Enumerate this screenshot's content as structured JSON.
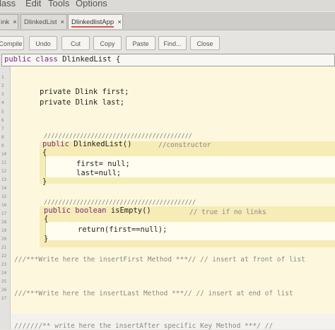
{
  "menu": {
    "items": [
      "lass",
      "Edit",
      "Tools",
      "Options"
    ]
  },
  "tabs": [
    {
      "label": "ink",
      "close": "×"
    },
    {
      "label": "DlinkedList",
      "close": "×"
    },
    {
      "label": "DlinkedlistApp",
      "close": "×"
    }
  ],
  "toolbar": {
    "buttons": [
      "Compile",
      "Undo",
      "Cut",
      "Copy",
      "Paste",
      "Find...",
      "Close"
    ]
  },
  "editor": {
    "line_numbers": [
      "1",
      "2",
      "3",
      "4",
      "5",
      "6",
      "7",
      "8",
      "9",
      "10",
      "11",
      "12",
      "13",
      "14",
      "15",
      "16",
      "17",
      "18",
      "19",
      "20",
      "21",
      "22",
      "23",
      "24",
      "25",
      "26",
      "27"
    ],
    "class_header": {
      "kw": "public class",
      "rest": " DlinkedList {"
    },
    "fields": [
      "private Dlink first;",
      "private Dlink last;"
    ],
    "ctor_sep": "/////////////////////////////////////////",
    "ctor_kw": "public",
    "ctor_sig": " DlinkedList()",
    "ctor_comment": "//constructor",
    "ctor_open": "{",
    "ctor_body": [
      "first= null;",
      "last=null;"
    ],
    "ctor_close": "}",
    "isempty_sep": "//////////////////////////////////////////",
    "isempty_kw": "public boolean",
    "isempty_sig": " isEmpty()",
    "isempty_comment": "// true if no links",
    "isempty_open": "{",
    "isempty_body": "return(first==null);",
    "isempty_close": "}",
    "comment1": "///***Write here the insertFirst Method ***// // insert at front of list",
    "comment2": "///***Write here the insertLast Method ***// // insert at end of list",
    "comment3": "///////** write here the insertAfter specific Key Method ***/ //"
  }
}
